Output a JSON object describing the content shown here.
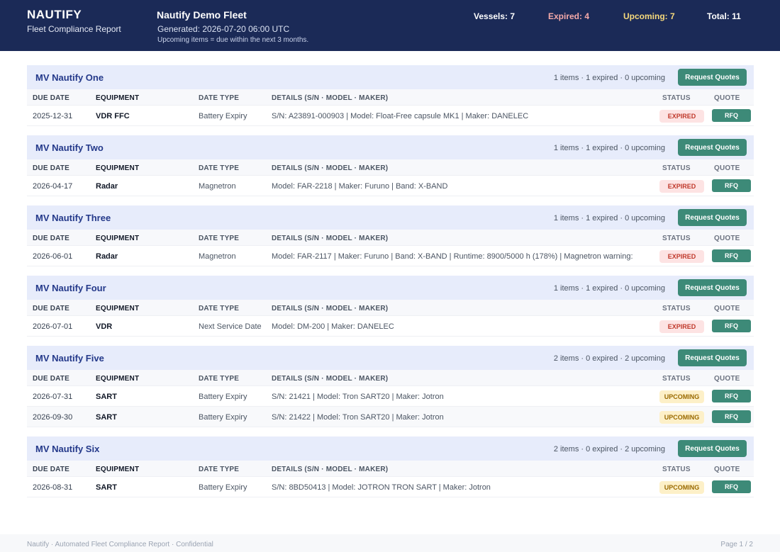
{
  "header": {
    "brand": "NAUTIFY",
    "subtitle": "Fleet Compliance Report",
    "fleet_name": "Nautify Demo Fleet",
    "generated": "Generated: 2026-07-20 06:00 UTC",
    "note": "Upcoming items = due within the next 3 months.",
    "stats": {
      "vessels": "Vessels: 7",
      "expired": "Expired: 4",
      "upcoming": "Upcoming: 7",
      "total": "Total: 11"
    }
  },
  "columns": {
    "due_date": "DUE DATE",
    "equipment": "EQUIPMENT",
    "date_type": "DATE TYPE",
    "details": "DETAILS (S/N · MODEL · MAKER)",
    "status": "STATUS",
    "quote": "QUOTE"
  },
  "request_quotes_label": "Request Quotes",
  "rfq_label": "RFQ",
  "vessels": [
    {
      "name": "MV Nautify One",
      "summary": "1 items · 1 expired · 0 upcoming",
      "rows": [
        {
          "due_date": "2025-12-31",
          "equipment": "VDR FFC",
          "date_type": "Battery Expiry",
          "details": "S/N: A23891-000903 | Model: Float-Free capsule MK1 | Maker: DANELEC",
          "status": "EXPIRED"
        }
      ]
    },
    {
      "name": "MV Nautify Two",
      "summary": "1 items · 1 expired · 0 upcoming",
      "rows": [
        {
          "due_date": "2026-04-17",
          "equipment": "Radar",
          "date_type": "Magnetron",
          "details": "Model: FAR-2218 | Maker: Furuno | Band: X-BAND",
          "status": "EXPIRED"
        }
      ]
    },
    {
      "name": "MV Nautify Three",
      "summary": "1 items · 1 expired · 0 upcoming",
      "rows": [
        {
          "due_date": "2026-06-01",
          "equipment": "Radar",
          "date_type": "Magnetron",
          "details": "Model: FAR-2117 | Maker: Furuno | Band: X-BAND | Runtime: 8900/5000 h (178%) | Magnetron warning:",
          "status": "EXPIRED"
        }
      ]
    },
    {
      "name": "MV Nautify Four",
      "summary": "1 items · 1 expired · 0 upcoming",
      "rows": [
        {
          "due_date": "2026-07-01",
          "equipment": "VDR",
          "date_type": "Next Service Date",
          "details": "Model: DM-200 | Maker: DANELEC",
          "status": "EXPIRED"
        }
      ]
    },
    {
      "name": "MV Nautify Five",
      "summary": "2 items · 0 expired · 2 upcoming",
      "rows": [
        {
          "due_date": "2026-07-31",
          "equipment": "SART",
          "date_type": "Battery Expiry",
          "details": "S/N: 21421 | Model: Tron SART20 | Maker: Jotron",
          "status": "UPCOMING"
        },
        {
          "due_date": "2026-09-30",
          "equipment": "SART",
          "date_type": "Battery Expiry",
          "details": "S/N: 21422 | Model: Tron SART20 | Maker: Jotron",
          "status": "UPCOMING"
        }
      ]
    },
    {
      "name": "MV Nautify Six",
      "summary": "2 items · 0 expired · 2 upcoming",
      "rows": [
        {
          "due_date": "2026-08-31",
          "equipment": "SART",
          "date_type": "Battery Expiry",
          "details": "S/N: 8BD50413 | Model: JOTRON TRON SART | Maker: Jotron",
          "status": "UPCOMING"
        }
      ]
    }
  ],
  "footer": {
    "left": "Nautify · Automated Fleet Compliance Report · Confidential",
    "right": "Page 1 / 2"
  },
  "colors": {
    "header_bg": "#1b2a57",
    "accent_green": "#3d8a78",
    "expired": "#c0392b",
    "upcoming": "#9a6a00",
    "section_title": "#24398a"
  }
}
